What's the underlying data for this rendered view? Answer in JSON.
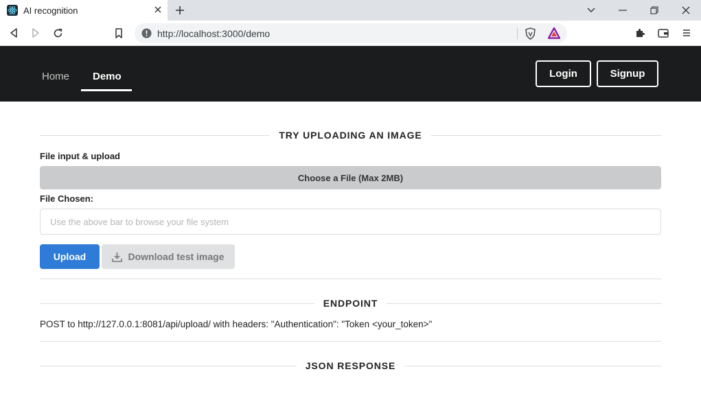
{
  "browser": {
    "tab_title": "AI recognition",
    "url": "http://localhost:3000/demo"
  },
  "navbar": {
    "items": [
      {
        "label": "Home",
        "active": false
      },
      {
        "label": "Demo",
        "active": true
      }
    ],
    "login_label": "Login",
    "signup_label": "Signup"
  },
  "upload_section": {
    "title": "TRY UPLOADING AN IMAGE",
    "file_input_label": "File input & upload",
    "choose_file_label": "Choose a File (Max 2MB)",
    "file_chosen_label": "File Chosen:",
    "file_chosen_value": "",
    "file_chosen_placeholder": "Use the above bar to browse your file system",
    "upload_label": "Upload",
    "download_label": "Download test image"
  },
  "endpoint_section": {
    "title": "ENDPOINT",
    "text": "POST to http://127.0.0.1:8081/api/upload/ with headers: \"Authentication\": \"Token <your_token>\""
  },
  "response_section": {
    "title": "JSON RESPONSE"
  },
  "colors": {
    "navbar_bg": "#1b1c1d",
    "primary_button": "#2f7bd8",
    "file_bar": "#cacbcd"
  }
}
